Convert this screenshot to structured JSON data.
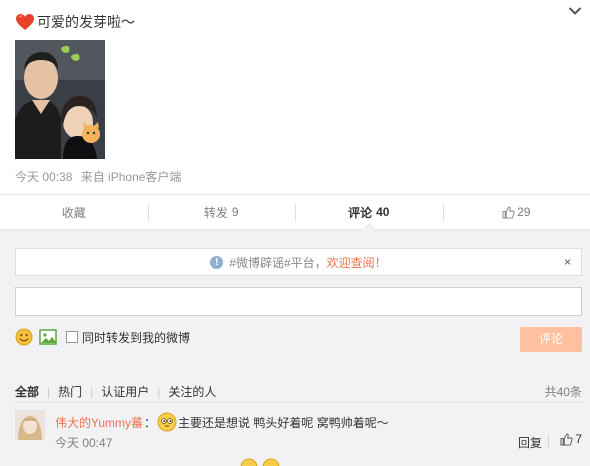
{
  "post": {
    "text": "可爱的发芽啦～",
    "emoji_icon": "heart-icon",
    "time": "今天 00:38",
    "source": "来自 iPhone客户端"
  },
  "actions": [
    {
      "label": "收藏",
      "count": ""
    },
    {
      "label": "转发",
      "count": "9"
    },
    {
      "label": "评论",
      "count": "40"
    },
    {
      "label": "",
      "count": "29",
      "icon": "thumbs-up-icon"
    }
  ],
  "notice": {
    "icon": "info-icon",
    "text_prefix": "#微博辟谣#平台，",
    "link": "欢迎查阅！",
    "close": "×"
  },
  "composer": {
    "value": "",
    "emoji_icon": "smiley-icon",
    "image_icon": "image-icon",
    "forward_label": "同时转发到我的微博",
    "forward_checked": false,
    "submit_label": "评论"
  },
  "filters": {
    "items": [
      "全部",
      "热门",
      "认证用户",
      "关注的人"
    ],
    "total": "共40条"
  },
  "comments": [
    {
      "user": "伟大的Yummy蕃",
      "colon": "：",
      "text": "主要还是想说 鸭头好着呢 窝鸭帅着呢～",
      "time": "今天 00:47",
      "reply_label": "回复",
      "likes": "7"
    }
  ],
  "colors": {
    "accent": "#eb7350",
    "submit_disabled": "#ffc09f",
    "panel_bg": "#f2f2f5"
  }
}
